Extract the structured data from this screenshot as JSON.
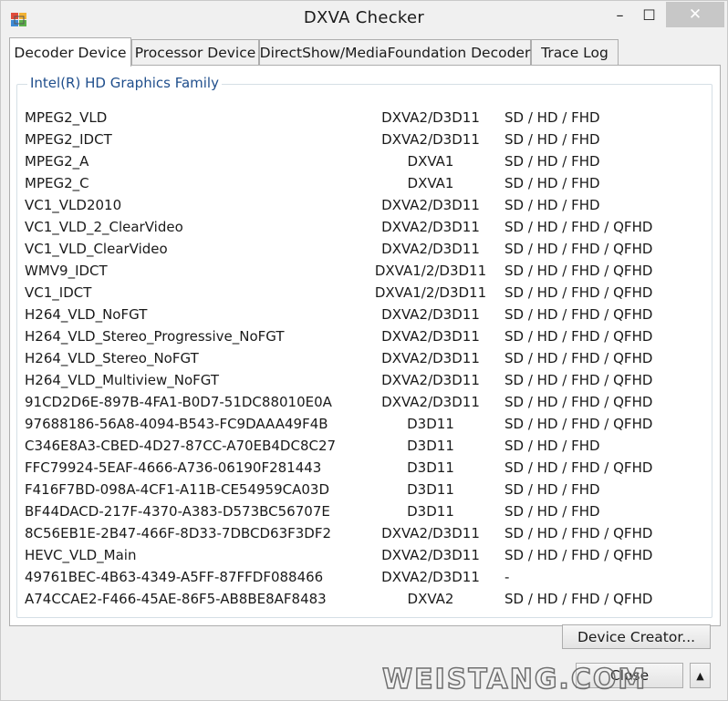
{
  "window": {
    "title": "DXVA Checker"
  },
  "caption": {
    "minimize": "–",
    "maximize": "☐",
    "close": "✕"
  },
  "tabs": [
    {
      "label": "Decoder Device"
    },
    {
      "label": "Processor Device"
    },
    {
      "label": "DirectShow/MediaFoundation Decoder"
    },
    {
      "label": "Trace Log"
    }
  ],
  "group": {
    "title": "Intel(R) HD Graphics Family"
  },
  "decoders": [
    {
      "name": "MPEG2_VLD",
      "api": "DXVA2/D3D11",
      "res": "SD / HD / FHD"
    },
    {
      "name": "MPEG2_IDCT",
      "api": "DXVA2/D3D11",
      "res": "SD / HD / FHD"
    },
    {
      "name": "MPEG2_A",
      "api": "DXVA1",
      "res": "SD / HD / FHD"
    },
    {
      "name": "MPEG2_C",
      "api": "DXVA1",
      "res": "SD / HD / FHD"
    },
    {
      "name": "VC1_VLD2010",
      "api": "DXVA2/D3D11",
      "res": "SD / HD / FHD"
    },
    {
      "name": "VC1_VLD_2_ClearVideo",
      "api": "DXVA2/D3D11",
      "res": "SD / HD / FHD / QFHD"
    },
    {
      "name": "VC1_VLD_ClearVideo",
      "api": "DXVA2/D3D11",
      "res": "SD / HD / FHD / QFHD"
    },
    {
      "name": "WMV9_IDCT",
      "api": "DXVA1/2/D3D11",
      "res": "SD / HD / FHD / QFHD"
    },
    {
      "name": "VC1_IDCT",
      "api": "DXVA1/2/D3D11",
      "res": "SD / HD / FHD / QFHD"
    },
    {
      "name": "H264_VLD_NoFGT",
      "api": "DXVA2/D3D11",
      "res": "SD / HD / FHD / QFHD"
    },
    {
      "name": "H264_VLD_Stereo_Progressive_NoFGT",
      "api": "DXVA2/D3D11",
      "res": "SD / HD / FHD / QFHD"
    },
    {
      "name": "H264_VLD_Stereo_NoFGT",
      "api": "DXVA2/D3D11",
      "res": "SD / HD / FHD / QFHD"
    },
    {
      "name": "H264_VLD_Multiview_NoFGT",
      "api": "DXVA2/D3D11",
      "res": "SD / HD / FHD / QFHD"
    },
    {
      "name": "91CD2D6E-897B-4FA1-B0D7-51DC88010E0A",
      "api": "DXVA2/D3D11",
      "res": "SD / HD / FHD / QFHD"
    },
    {
      "name": "97688186-56A8-4094-B543-FC9DAAA49F4B",
      "api": "D3D11",
      "res": "SD / HD / FHD / QFHD"
    },
    {
      "name": "C346E8A3-CBED-4D27-87CC-A70EB4DC8C27",
      "api": "D3D11",
      "res": "SD / HD / FHD"
    },
    {
      "name": "FFC79924-5EAF-4666-A736-06190F281443",
      "api": "D3D11",
      "res": "SD / HD / FHD / QFHD"
    },
    {
      "name": "F416F7BD-098A-4CF1-A11B-CE54959CA03D",
      "api": "D3D11",
      "res": "SD / HD / FHD"
    },
    {
      "name": "BF44DACD-217F-4370-A383-D573BC56707E",
      "api": "D3D11",
      "res": "SD / HD / FHD"
    },
    {
      "name": "8C56EB1E-2B47-466F-8D33-7DBCD63F3DF2",
      "api": "DXVA2/D3D11",
      "res": "SD / HD / FHD / QFHD"
    },
    {
      "name": "HEVC_VLD_Main",
      "api": "DXVA2/D3D11",
      "res": "SD / HD / FHD / QFHD"
    },
    {
      "name": "49761BEC-4B63-4349-A5FF-87FFDF088466",
      "api": "DXVA2/D3D11",
      "res": "-"
    },
    {
      "name": "A74CCAE2-F466-45AE-86F5-AB8BE8AF8483",
      "api": "DXVA2",
      "res": "SD / HD / FHD / QFHD"
    }
  ],
  "buttons": {
    "device_creator": "Device Creator...",
    "close": "Close",
    "arrow": "▲"
  },
  "watermark": "WEISTANG.COM"
}
